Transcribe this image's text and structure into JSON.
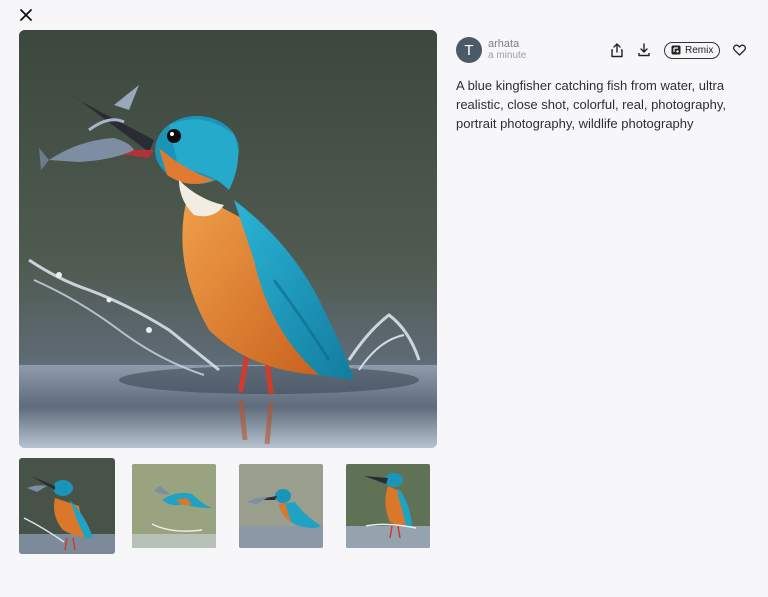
{
  "close": {
    "icon": "close-icon"
  },
  "image": {
    "alt": "A blue kingfisher catching fish from water, ultra realistic, close shot, colorful, real, photography, portrait photography, wildlife photography"
  },
  "thumbnails": [
    {
      "selected": true
    },
    {
      "selected": false
    },
    {
      "selected": false
    },
    {
      "selected": false
    }
  ],
  "author": {
    "initial": "T",
    "name": "arhata",
    "time": "a minute"
  },
  "actions": {
    "share_icon": "share-icon",
    "download_icon": "download-icon",
    "remix_label": "Remix",
    "like_icon": "heart-icon"
  },
  "prompt": "A blue kingfisher catching fish from water, ultra realistic, close shot, colorful, real, photography, portrait photography, wildlife photography",
  "colors": {
    "background": "#f7f7f9",
    "avatar": "#4a5a66",
    "kingfisher_blue": "#1fa3c4",
    "kingfisher_orange": "#d9782a"
  }
}
